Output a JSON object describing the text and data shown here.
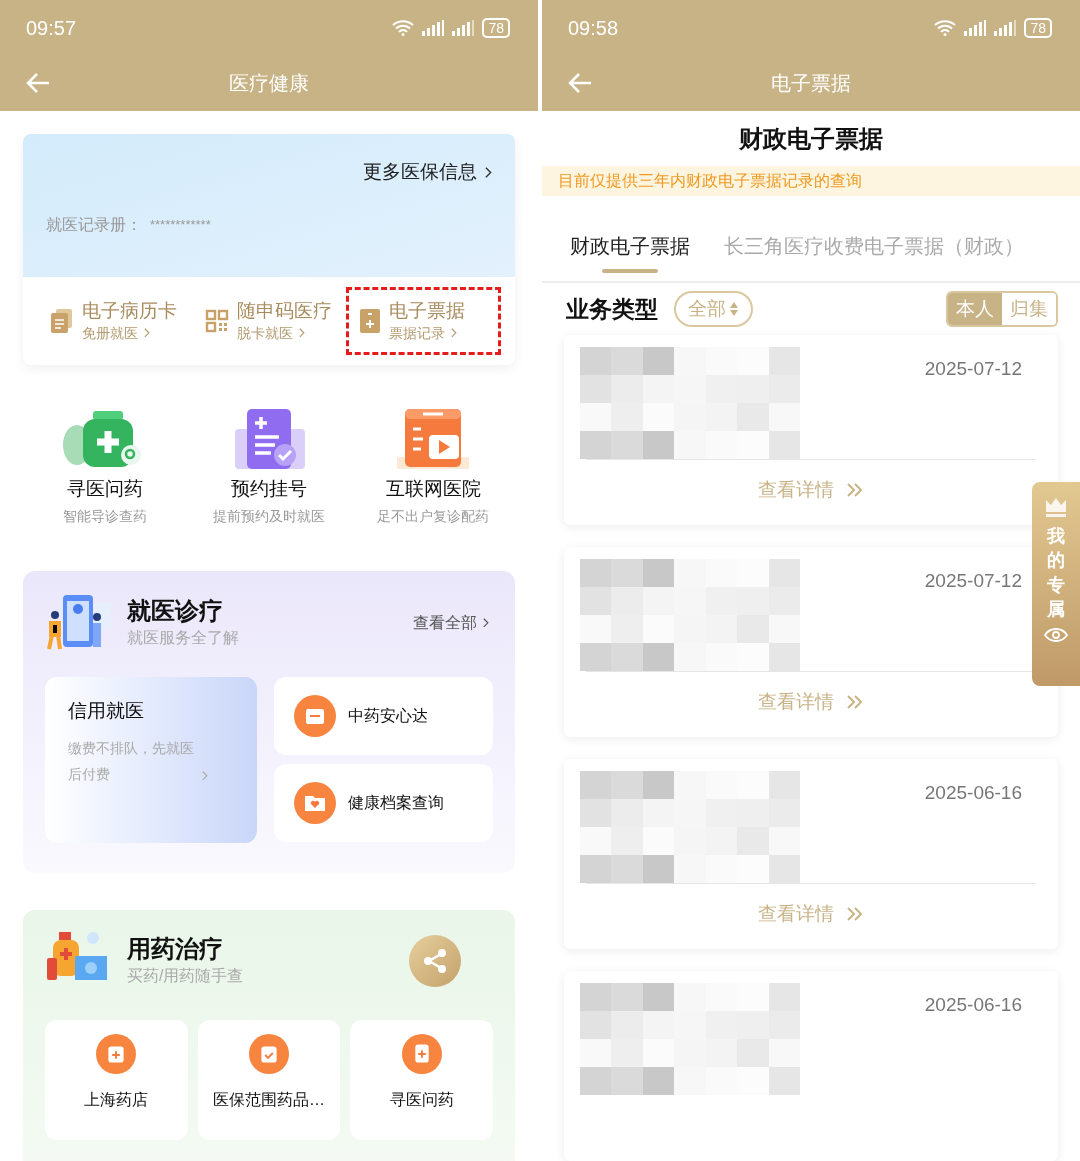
{
  "left_screen": {
    "status_bar": {
      "time": "09:57",
      "battery": "78"
    },
    "header": {
      "title": "医疗健康"
    },
    "insurance_card": {
      "link": "更多医保信息",
      "record_label": "就医记录册：",
      "record_value": "************"
    },
    "quick_links": [
      {
        "kind": "card",
        "title": "电子病历卡",
        "subtitle": "免册就医",
        "highlighted": false
      },
      {
        "kind": "qr",
        "title": "随申码医疗",
        "subtitle": "脱卡就医",
        "highlighted": false
      },
      {
        "kind": "receipt",
        "title": "电子票据",
        "subtitle": "票据记录",
        "highlighted": true
      }
    ],
    "features": [
      {
        "kind": "medicine",
        "title": "寻医问药",
        "subtitle": "智能导诊查药"
      },
      {
        "kind": "register",
        "title": "预约挂号",
        "subtitle": "提前预约及时就医"
      },
      {
        "kind": "hospital",
        "title": "互联网医院",
        "subtitle": "足不出户复诊配药"
      }
    ],
    "clinic_section": {
      "title": "就医诊疗",
      "subtitle": "就医服务全了解",
      "link": "查看全部",
      "promo": {
        "title": "信用就医",
        "text": "缴费不排队，先就医后付费"
      },
      "services": [
        {
          "kind": "box",
          "label": "中药安心达"
        },
        {
          "kind": "folder",
          "label": "健康档案查询"
        }
      ]
    },
    "medicine_section": {
      "title": "用药治疗",
      "subtitle": "买药/用药随手查",
      "tiles": [
        {
          "kind": "store",
          "label": "上海药店"
        },
        {
          "kind": "check",
          "label": "医保范围药品…"
        },
        {
          "kind": "plus",
          "label": "寻医问药"
        }
      ]
    }
  },
  "right_screen": {
    "status_bar": {
      "time": "09:58",
      "battery": "78"
    },
    "header": {
      "title": "电子票据"
    },
    "page_title": "财政电子票据",
    "notice": "目前仅提供三年内财政电子票据记录的查询",
    "tabs": [
      {
        "label": "财政电子票据",
        "selected": true
      },
      {
        "label": "长三角医疗收费电子票据（财政）",
        "selected": false
      }
    ],
    "filter": {
      "label": "业务类型",
      "dropdown": "全部",
      "scopes": [
        {
          "label": "本人",
          "selected": true
        },
        {
          "label": "归集",
          "selected": false
        }
      ]
    },
    "records": [
      {
        "date": "2025-07-12",
        "action": "查看详情"
      },
      {
        "date": "2025-07-12",
        "action": "查看详情"
      },
      {
        "date": "2025-06-16",
        "action": "查看详情"
      },
      {
        "date": "2025-06-16"
      }
    ],
    "floating_tab": {
      "label": "我的专属"
    }
  }
}
